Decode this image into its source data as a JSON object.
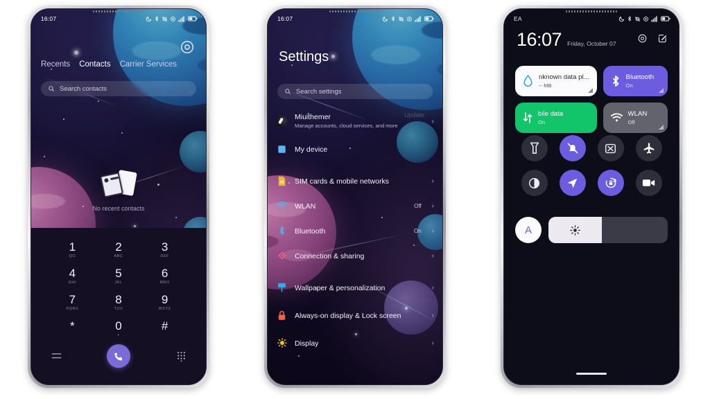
{
  "meta": {
    "accent_purple": "#6c5ce0",
    "green": "#12c46a",
    "gray": "#63636e",
    "bg": "#ffffff"
  },
  "phone1": {
    "status": {
      "time": "16:07",
      "icons": [
        "dnd-moon-icon",
        "bluetooth-icon",
        "vibrate-off-icon",
        "location-icon",
        "signal-icon",
        "battery-icon"
      ]
    },
    "app": "Phone",
    "tabs": [
      {
        "label": "Recents",
        "active": true
      },
      {
        "label": "Contacts",
        "active": false
      },
      {
        "label": "Carrier Services",
        "active": false
      }
    ],
    "search": {
      "placeholder": "Search contacts"
    },
    "empty": {
      "text": "No recent contacts"
    },
    "keypad": [
      {
        "num": "1",
        "sub": "QO"
      },
      {
        "num": "2",
        "sub": "ABC"
      },
      {
        "num": "3",
        "sub": "DEF"
      },
      {
        "num": "4",
        "sub": "GHI"
      },
      {
        "num": "5",
        "sub": "JKL"
      },
      {
        "num": "6",
        "sub": "MNO"
      },
      {
        "num": "7",
        "sub": "PQRS"
      },
      {
        "num": "8",
        "sub": "TUV"
      },
      {
        "num": "9",
        "sub": "WXYZ"
      },
      {
        "num": "*",
        "sub": ","
      },
      {
        "num": "0",
        "sub": "+"
      },
      {
        "num": "#",
        "sub": ""
      }
    ],
    "actions": {
      "menu": "menu-icon",
      "call": "call-icon",
      "dialpad": "dialpad-icon"
    }
  },
  "phone2": {
    "status": {
      "time": "16:07"
    },
    "title": "Settings",
    "search": {
      "placeholder": "Search settings"
    },
    "ghost_label": "Update",
    "items": [
      {
        "label": "Miuithemer",
        "sub": "Manage accounts, cloud services, and more",
        "value": "",
        "icon": "account-avatar-icon",
        "chevron": true
      },
      {
        "label": "My device",
        "sub": "",
        "value": "",
        "icon": "device-icon",
        "chevron": false
      },
      {
        "label": "SIM cards & mobile networks",
        "sub": "",
        "value": "",
        "icon": "sim-icon",
        "chevron": true
      },
      {
        "label": "WLAN",
        "sub": "",
        "value": "Off",
        "icon": "wifi-icon",
        "chevron": true
      },
      {
        "label": "Bluetooth",
        "sub": "",
        "value": "On",
        "icon": "bluetooth-icon",
        "chevron": true
      },
      {
        "label": "Connection & sharing",
        "sub": "",
        "value": "",
        "icon": "sharing-icon",
        "chevron": true
      },
      {
        "label": "Wallpaper & personalization",
        "sub": "",
        "value": "",
        "icon": "wallpaper-icon",
        "chevron": true
      },
      {
        "label": "Always-on display & Lock screen",
        "sub": "",
        "value": "",
        "icon": "lock-icon",
        "chevron": true
      },
      {
        "label": "Display",
        "sub": "",
        "value": "",
        "icon": "brightness-icon",
        "chevron": true
      }
    ]
  },
  "phone3": {
    "status": {
      "carrier": "EA"
    },
    "clock": {
      "time": "16:07",
      "date": "Friday, October 07"
    },
    "header_icons": [
      "settings-gear-icon",
      "edit-icon"
    ],
    "tiles": [
      {
        "title": "nknown data pl...",
        "sub": "-- MB",
        "style": "white",
        "icon": "data-drop-icon"
      },
      {
        "title": "Bluetooth",
        "sub": "On",
        "style": "purple",
        "icon": "bluetooth-icon"
      },
      {
        "title": "bile data",
        "sub": "On",
        "style": "green",
        "icon": "mobile-data-icon"
      },
      {
        "title": "WLAN",
        "sub": "Off",
        "style": "gray",
        "icon": "wifi-icon"
      }
    ],
    "toggles": [
      {
        "name": "flashlight",
        "on": false,
        "icon": "flashlight-icon"
      },
      {
        "name": "silent",
        "on": true,
        "icon": "bell-off-icon"
      },
      {
        "name": "screenshot",
        "on": false,
        "icon": "screenshot-icon"
      },
      {
        "name": "airplane-mode",
        "on": false,
        "icon": "airplane-icon"
      },
      {
        "name": "dark-mode",
        "on": false,
        "icon": "contrast-icon"
      },
      {
        "name": "location",
        "on": true,
        "icon": "location-arrow-icon"
      },
      {
        "name": "auto-rotate",
        "on": true,
        "icon": "rotate-lock-icon"
      },
      {
        "name": "screen-recorder",
        "on": false,
        "icon": "video-camera-icon"
      }
    ],
    "brightness": {
      "auto_label": "A",
      "level_percent": 45,
      "icon": "sun-icon"
    }
  }
}
